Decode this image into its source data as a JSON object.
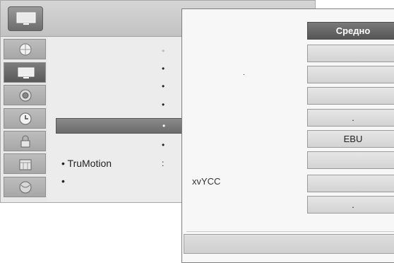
{
  "menu": {
    "header_icon": "tv-icon",
    "sidebar_icons": [
      "globe-icon",
      "tv-screen-icon",
      "speaker-icon",
      "clock-icon",
      "lock-icon",
      "calendar-icon",
      "network-icon"
    ],
    "rows": [
      {
        "label": "",
        "marker": "•"
      },
      {
        "label": "",
        "marker": "•"
      },
      {
        "label": "",
        "marker": "•"
      },
      {
        "label": "",
        "marker": "•"
      },
      {
        "label": "",
        "marker": "•"
      },
      {
        "label": "",
        "marker": "•"
      },
      {
        "label": "• TruMotion",
        "marker": ":"
      },
      {
        "label": "•",
        "marker": ""
      }
    ]
  },
  "submenu": {
    "dot": ".",
    "left_label": "xvYCC",
    "options": [
      "Средно",
      "",
      "",
      "",
      ".",
      "EBU",
      "",
      "",
      "."
    ]
  }
}
